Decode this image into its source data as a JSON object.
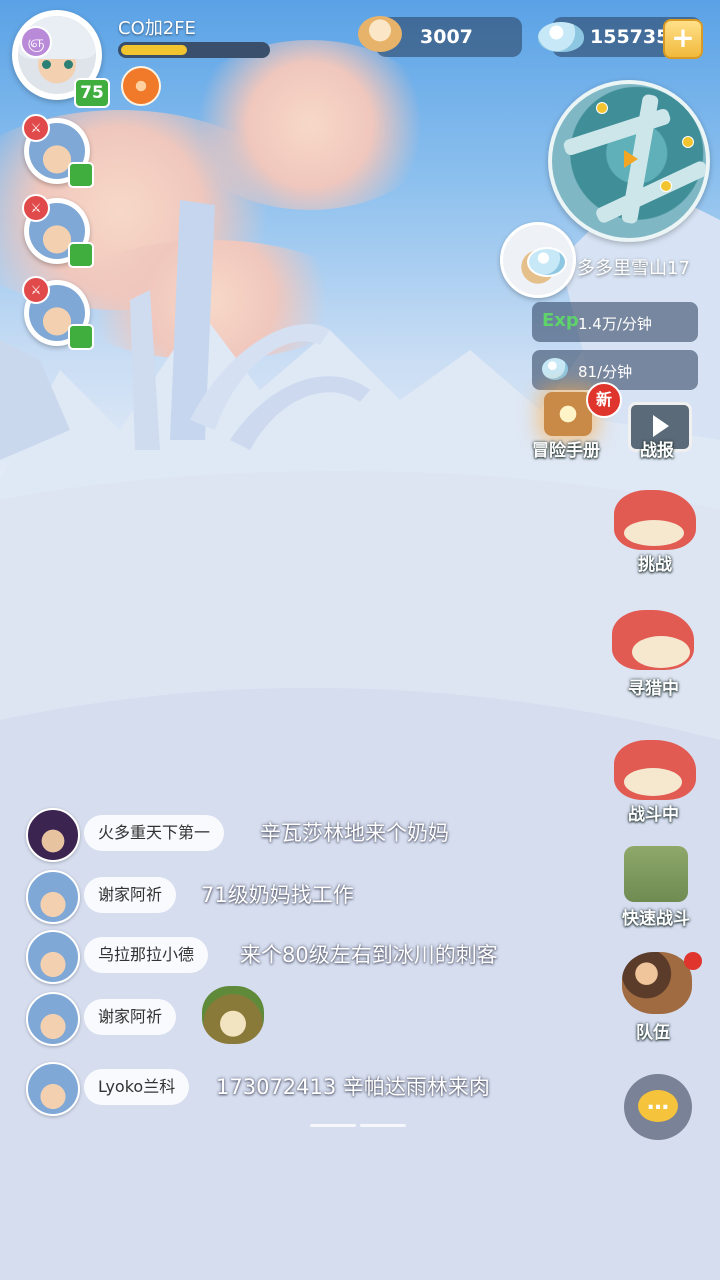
{
  "player": {
    "name": "CO加2FE",
    "level": "75",
    "xp_fraction": 0.45
  },
  "currencies": {
    "shells": "3007",
    "gems": "155735",
    "plus": "+"
  },
  "party": {
    "badge_glyph": "⚔"
  },
  "zone": {
    "name": "多多里雪山17"
  },
  "rates": {
    "exp_label": "Exp",
    "exp_rate": "1.4万/分钟",
    "gem_rate": "81/分钟"
  },
  "side_menu": {
    "handbook": "冒险手册",
    "new_badge": "新",
    "battle_report": "战报",
    "challenge": "挑战",
    "hunting": "寻猎中",
    "fighting": "战斗中",
    "quick_battle": "快速战斗",
    "team": "队伍"
  },
  "chat": {
    "messages": [
      {
        "name": "火多重天下第一",
        "text": "辛瓦莎林地来个奶妈"
      },
      {
        "name": "谢家阿祈",
        "text": "71级奶妈找工作"
      },
      {
        "name": "乌拉那拉小德",
        "text": "来个80级左右到冰川的刺客"
      },
      {
        "name": "谢家阿祈",
        "text": ""
      },
      {
        "name": "Lyoko兰科",
        "text": "173072413 辛帕达雨林来肉"
      }
    ],
    "bubble_glyph": "…"
  },
  "colors": {
    "accent_gold": "#f2c530",
    "level_green": "#3fae3f",
    "alert_red": "#e0352d",
    "dino_red": "#e25b52"
  }
}
